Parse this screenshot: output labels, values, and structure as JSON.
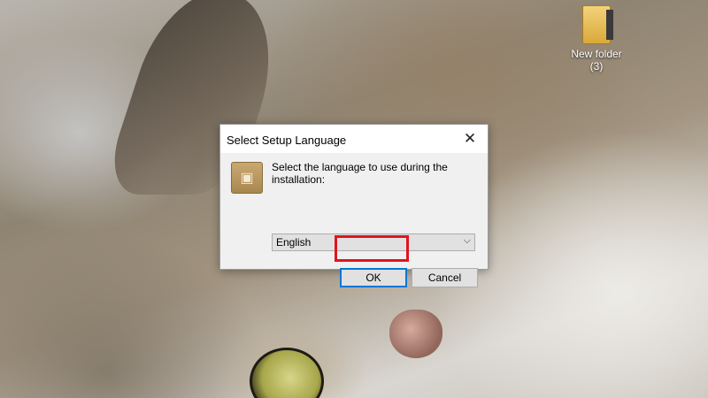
{
  "desktop": {
    "folder_icon": {
      "name_line1": "New folder",
      "name_line2": "(3)",
      "icon": "folder-icon"
    }
  },
  "dialog": {
    "title": "Select Setup Language",
    "close_glyph": "✕",
    "app_icon": "installer-box-icon",
    "prompt": "Select the language to use during the installation:",
    "language_select": {
      "selected": "English",
      "chevron": "⌵"
    },
    "ok_label": "OK",
    "cancel_label": "Cancel"
  },
  "colors": {
    "highlight": "#e0141e",
    "focus": "#0078d7",
    "dialog_bg": "#f0f0f0"
  }
}
